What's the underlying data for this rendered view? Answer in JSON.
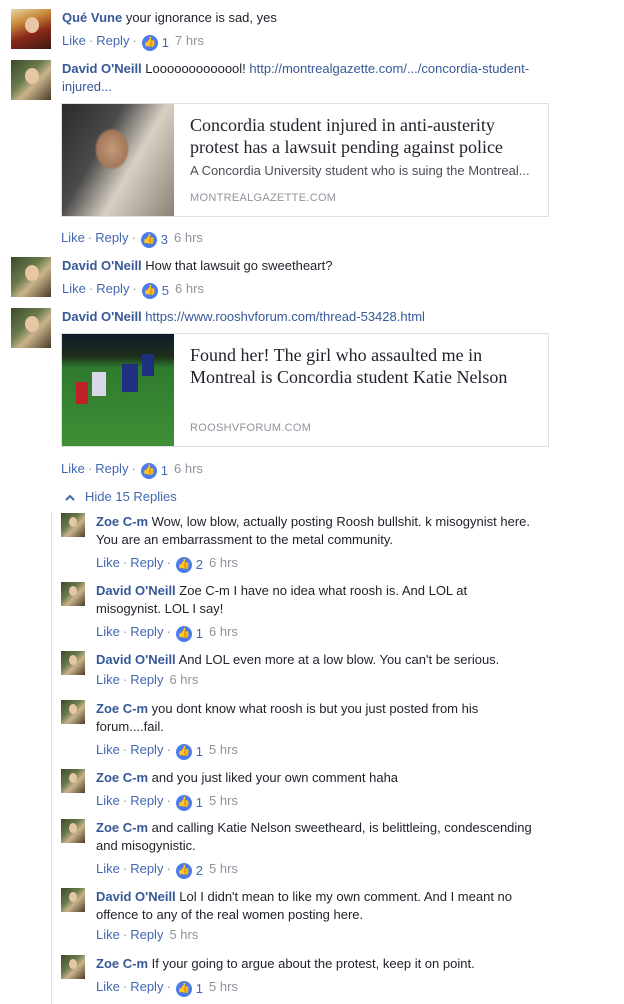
{
  "actions": {
    "like": "Like",
    "reply": "Reply",
    "sep": "·"
  },
  "comments": [
    {
      "name": "Qué Vune",
      "text": "your ignorance is sad, yes",
      "likes": "1",
      "time": "7 hrs"
    },
    {
      "name": "David O'Neill",
      "text": "Looooooooooool!",
      "link_line1": "http://montrealgazette.com/.../concordia-student-",
      "link_line2": "injured...",
      "likes": "3",
      "time": "6 hrs",
      "preview": {
        "title": "Concordia student injured in anti-austerity protest has a lawsuit pending against police",
        "description": "A Concordia University student who is suing the Montreal...",
        "domain": "MONTREALGAZETTE.COM"
      }
    },
    {
      "name": "David O'Neill",
      "text": "How that lawsuit go sweetheart?",
      "likes": "5",
      "time": "6 hrs"
    },
    {
      "name": "David O'Neill",
      "link": "https://www.rooshvforum.com/thread-53428.html",
      "likes": "1",
      "time": "6 hrs",
      "preview": {
        "title": "Found her! The girl who assaulted me in Montreal is Concordia student Katie Nelson",
        "domain": "ROOSHVFORUM.COM"
      }
    }
  ],
  "hide_replies": "Hide 15 Replies",
  "replies": [
    {
      "name": "Zoe C-m",
      "line1": "Wow, low blow, actually posting Roosh bullshit. k misogynist here.",
      "line2": "You are an embarrassment to the metal community.",
      "likes": "2",
      "time": "6 hrs"
    },
    {
      "name": "David O'Neill",
      "line1": "Zoe C-m I have no idea what roosh is. And LOL at",
      "line2": "misogynist. LOL I say!",
      "likes": "1",
      "time": "6 hrs"
    },
    {
      "name": "David O'Neill",
      "line1": "And LOL even more at a low blow. You can't be serious.",
      "time": "6 hrs"
    },
    {
      "name": "Zoe C-m",
      "line1": "you dont know what roosh is but you just posted from his",
      "line2": "forum....fail.",
      "likes": "1",
      "time": "5 hrs"
    },
    {
      "name": "Zoe C-m",
      "line1": "and you just liked your own comment haha",
      "likes": "1",
      "time": "5 hrs"
    },
    {
      "name": "Zoe C-m",
      "line1": "and calling Katie Nelson sweetheard, is belittleing, condescending",
      "line2": "and misogynistic.",
      "likes": "2",
      "time": "5 hrs"
    },
    {
      "name": "David O'Neill",
      "line1": "Lol I didn't mean to like my own comment. And I meant no",
      "line2": "offence to any of the real women posting here.",
      "time": "5 hrs"
    },
    {
      "name": "Zoe C-m",
      "line1": "If your going to argue about the protest, keep it on point.",
      "likes": "1",
      "time": "5 hrs"
    }
  ],
  "colors": {
    "link": "#365899",
    "action": "#4267b2",
    "meta": "#90949c",
    "like_badge": "#4a7cf0"
  }
}
